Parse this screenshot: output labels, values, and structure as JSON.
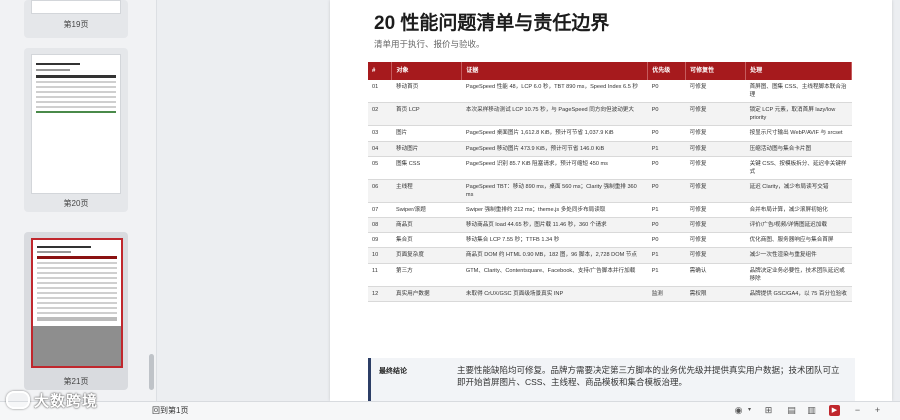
{
  "sidebar": {
    "thumbnails": [
      {
        "label": "第19页"
      },
      {
        "label": "第20页"
      },
      {
        "label": "第21页"
      }
    ]
  },
  "watermark": {
    "text": "大数跨境"
  },
  "document": {
    "title": "20 性能问题清单与责任边界",
    "subtitle": "清单用于执行、报价与验收。",
    "table": {
      "headers": [
        "#",
        "对象",
        "证据",
        "优先级",
        "可修复性",
        "处理"
      ],
      "rows": [
        [
          "01",
          "移动首页",
          "PageSpeed 性能 48，LCP 6.0 秒，TBT 890 ms，Speed Index 6.5 秒",
          "P0",
          "可修复",
          "首屏图、图集 CSS、主线程脚本联合治理"
        ],
        [
          "02",
          "首页 LCP",
          "本次采样移动测试 LCP 10.75 秒，与 PageSpeed 同方向但波动更大",
          "P0",
          "可修复",
          "锁定 LCP 元素，取消首屏 lazy/low priority"
        ],
        [
          "03",
          "图片",
          "PageSpeed 桌面图片 1,612.8 KiB，预计可节省 1,037.9 KiB",
          "P0",
          "可修复",
          "按显示尺寸输出 WebP/AVIF 与 srcset"
        ],
        [
          "04",
          "移动图片",
          "PageSpeed 移动图片 473.9 KiB，预计可节省 146.0 KiB",
          "P1",
          "可修复",
          "压缩活动图与集合卡片图"
        ],
        [
          "05",
          "图集 CSS",
          "PageSpeed 识别 85.7 KiB 阻塞请求，预计可缩短 450 ms",
          "P0",
          "可修复",
          "关键 CSS、按模板拆分、延迟非关键样式"
        ],
        [
          "06",
          "主线程",
          "PageSpeed TBT：移动 890 ms，桌面 560 ms；Clarity 强制重排 360 ms",
          "P0",
          "可修复",
          "延迟 Clarity，减少布局读写交错"
        ],
        [
          "07",
          "Swiper/滚题",
          "Swiper 强制重排约 212 ms；theme.js 多处同步布局读取",
          "P1",
          "可修复",
          "合并布局计算，减少滚屏初始化"
        ],
        [
          "08",
          "商品页",
          "移动商品页 load 44.65 秒，图片载 11.46 秒，360 个请求",
          "P0",
          "可修复",
          "评价/广告/视频/详情图延迟加载"
        ],
        [
          "09",
          "集合页",
          "移动集合 LCP 7.55 秒；TTFB 1.34 秒",
          "P0",
          "可修复",
          "优化商图、服务器响应与集合首屏"
        ],
        [
          "10",
          "页面复杂度",
          "商品页 DOM 约 HTML 0.90 MB，182 图，96 脚本，2,728 DOM 节点",
          "P1",
          "可修复",
          "减少一次性渲染与重复组件"
        ],
        [
          "11",
          "第三方",
          "GTM、Clarity、Contentsquare、Facebook、支持/广告脚本并行加载",
          "P1",
          "需确认",
          "品牌决定业务必要性，技术团队延迟或移除"
        ],
        [
          "12",
          "真实用户数据",
          "未取得 CrUX/GSC 页面级场景真实 INP",
          "监测",
          "需权限",
          "品牌提供 GSC/GA4，以 75 百分位验收"
        ]
      ]
    },
    "conclusion": {
      "label": "最终结论",
      "text": "主要性能缺陷均可修复。品牌方需要决定第三方脚本的业务优先级并提供真实用户数据；技术团队可立即开始首屏图片、CSS、主线程、商品模板和集合模板治理。"
    }
  },
  "statusbar": {
    "return_label": "回到第1页"
  }
}
